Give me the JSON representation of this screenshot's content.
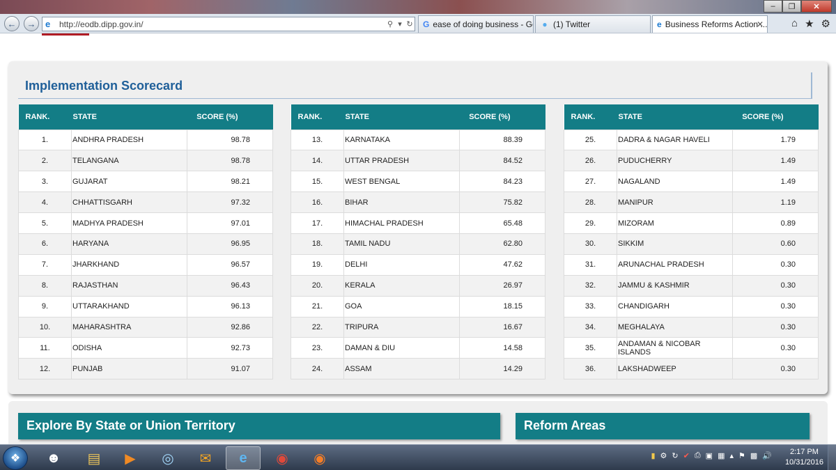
{
  "browser": {
    "url": "http://eodb.dipp.gov.in/",
    "tabs": [
      {
        "label": "ease of doing business - Goo...",
        "icon": "google-icon"
      },
      {
        "label": "(1) Twitter",
        "icon": "twitter-icon"
      },
      {
        "label": "Business Reforms Action ...",
        "icon": "ie-page-icon",
        "active": true
      }
    ]
  },
  "scorecard": {
    "title": "Implementation Scorecard",
    "headers": {
      "rank": "RANK.",
      "state": "STATE",
      "score": "SCORE (%)"
    },
    "columns": [
      [
        {
          "rank": "1.",
          "state": "ANDHRA PRADESH",
          "score": "98.78"
        },
        {
          "rank": "2.",
          "state": "TELANGANA",
          "score": "98.78"
        },
        {
          "rank": "3.",
          "state": "GUJARAT",
          "score": "98.21"
        },
        {
          "rank": "4.",
          "state": "CHHATTISGARH",
          "score": "97.32"
        },
        {
          "rank": "5.",
          "state": "MADHYA PRADESH",
          "score": "97.01"
        },
        {
          "rank": "6.",
          "state": "HARYANA",
          "score": "96.95"
        },
        {
          "rank": "7.",
          "state": "JHARKHAND",
          "score": "96.57"
        },
        {
          "rank": "8.",
          "state": "RAJASTHAN",
          "score": "96.43"
        },
        {
          "rank": "9.",
          "state": "UTTARAKHAND",
          "score": "96.13"
        },
        {
          "rank": "10.",
          "state": "MAHARASHTRA",
          "score": "92.86"
        },
        {
          "rank": "11.",
          "state": "ODISHA",
          "score": "92.73"
        },
        {
          "rank": "12.",
          "state": "PUNJAB",
          "score": "91.07"
        }
      ],
      [
        {
          "rank": "13.",
          "state": "KARNATAKA",
          "score": "88.39"
        },
        {
          "rank": "14.",
          "state": "UTTAR PRADESH",
          "score": "84.52"
        },
        {
          "rank": "15.",
          "state": "WEST BENGAL",
          "score": "84.23"
        },
        {
          "rank": "16.",
          "state": "BIHAR",
          "score": "75.82"
        },
        {
          "rank": "17.",
          "state": "HIMACHAL PRADESH",
          "score": "65.48"
        },
        {
          "rank": "18.",
          "state": "TAMIL NADU",
          "score": "62.80"
        },
        {
          "rank": "19.",
          "state": "DELHI",
          "score": "47.62"
        },
        {
          "rank": "20.",
          "state": "KERALA",
          "score": "26.97"
        },
        {
          "rank": "21.",
          "state": "GOA",
          "score": "18.15"
        },
        {
          "rank": "22.",
          "state": "TRIPURA",
          "score": "16.67"
        },
        {
          "rank": "23.",
          "state": "DAMAN & DIU",
          "score": "14.58"
        },
        {
          "rank": "24.",
          "state": "ASSAM",
          "score": "14.29"
        }
      ],
      [
        {
          "rank": "25.",
          "state": "DADRA & NAGAR HAVELI",
          "score": "1.79"
        },
        {
          "rank": "26.",
          "state": "PUDUCHERRY",
          "score": "1.49"
        },
        {
          "rank": "27.",
          "state": "NAGALAND",
          "score": "1.49"
        },
        {
          "rank": "28.",
          "state": "MANIPUR",
          "score": "1.19"
        },
        {
          "rank": "29.",
          "state": "MIZORAM",
          "score": "0.89"
        },
        {
          "rank": "30.",
          "state": "SIKKIM",
          "score": "0.60"
        },
        {
          "rank": "31.",
          "state": "ARUNACHAL PRADESH",
          "score": "0.30"
        },
        {
          "rank": "32.",
          "state": "JAMMU & KASHMIR",
          "score": "0.30"
        },
        {
          "rank": "33.",
          "state": "CHANDIGARH",
          "score": "0.30"
        },
        {
          "rank": "34.",
          "state": "MEGHALAYA",
          "score": "0.30"
        },
        {
          "rank": "35.",
          "state": "ANDAMAN & NICOBAR ISLANDS",
          "score": "0.30"
        },
        {
          "rank": "36.",
          "state": "LAKSHADWEEP",
          "score": "0.30"
        }
      ]
    ]
  },
  "sections": {
    "explore": "Explore By State or Union Territory",
    "reform": "Reform Areas"
  },
  "taskbar": {
    "time": "2:17 PM",
    "date": "10/31/2016"
  },
  "colors": {
    "header_teal": "#137d86",
    "title_blue": "#1f5f99"
  }
}
